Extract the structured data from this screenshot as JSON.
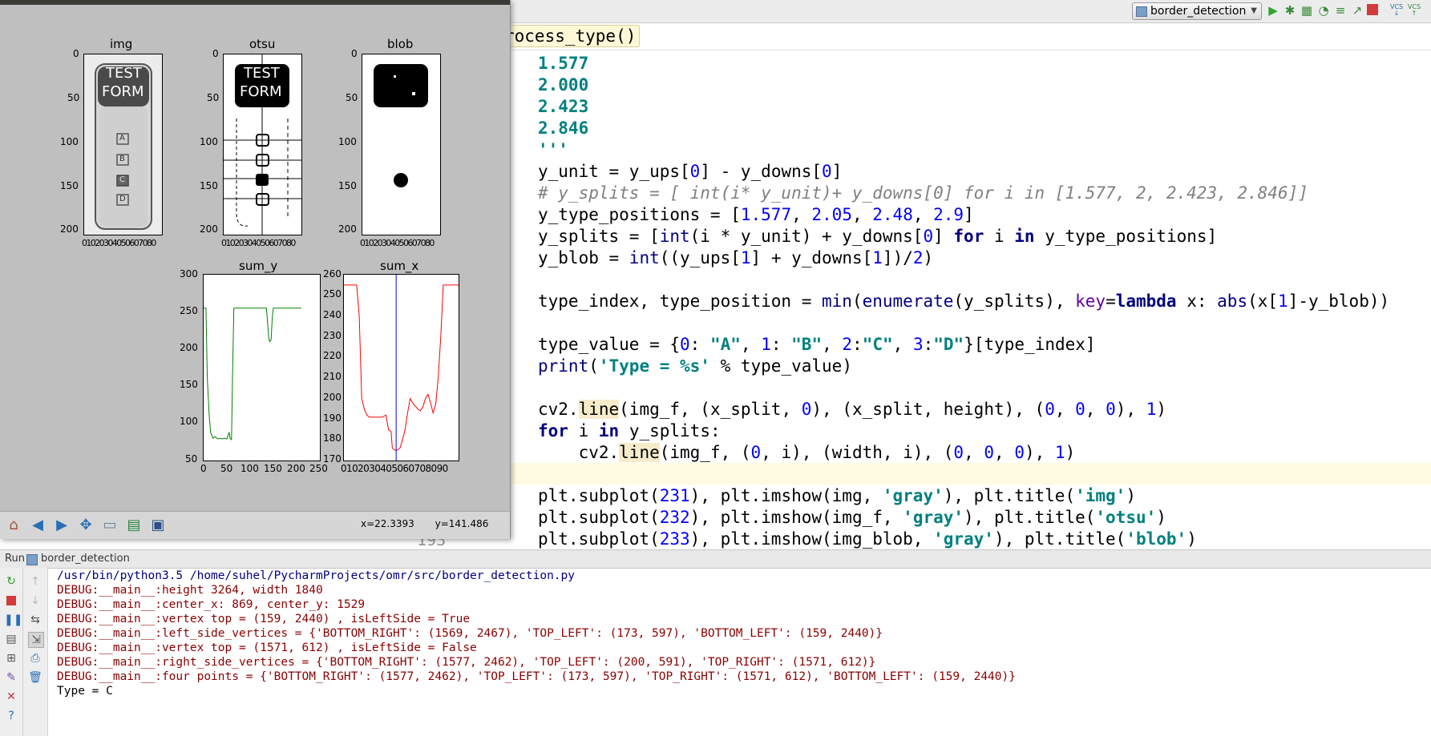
{
  "toolbar": {
    "run_config": "border_detection",
    "vcs_label": "VCS"
  },
  "editor": {
    "crumb": "rocess_type()",
    "behind_window_line_no": "193"
  },
  "matplotlib": {
    "coords": {
      "x": "x=22.3393",
      "y": "y=141.486"
    },
    "plots": {
      "img": {
        "title": "img",
        "form_text": [
          "TEST",
          "FORM"
        ],
        "options": [
          "A",
          "B",
          "C",
          "D"
        ]
      },
      "otsu": {
        "title": "otsu",
        "form_text": [
          "TEST",
          "FORM"
        ]
      },
      "blob": {
        "title": "blob"
      },
      "sum_y": {
        "title": "sum_y"
      },
      "sum_x": {
        "title": "sum_x"
      }
    },
    "image_axes": {
      "yticks": [
        "0",
        "50",
        "100",
        "150",
        "200"
      ],
      "xticks": "01020304050607080"
    },
    "sum_y_axes": {
      "yticks": [
        "300",
        "250",
        "200",
        "150",
        "100",
        "50"
      ],
      "xticks": [
        "0",
        "50",
        "100",
        "150",
        "200",
        "250"
      ]
    },
    "sum_x_axes": {
      "yticks": [
        "260",
        "250",
        "240",
        "230",
        "220",
        "210",
        "200",
        "190",
        "180",
        "170"
      ],
      "xticks": "0102030405060708090"
    }
  },
  "chart_data": [
    {
      "type": "line",
      "title": "sum_y",
      "xlim": [
        0,
        250
      ],
      "ylim": [
        50,
        300
      ],
      "series": [
        {
          "color": "#008000",
          "x": [
            0,
            5,
            8,
            12,
            15,
            20,
            25,
            30,
            35,
            40,
            45,
            50,
            55,
            57,
            60,
            62,
            65,
            70,
            80,
            100,
            120,
            135,
            137,
            140,
            142,
            145,
            148,
            150,
            155,
            180,
            210
          ],
          "y": [
            255,
            255,
            160,
            110,
            88,
            80,
            82,
            79,
            80,
            79,
            80,
            79,
            88,
            80,
            78,
            160,
            255,
            255,
            255,
            255,
            255,
            255,
            240,
            215,
            210,
            212,
            245,
            255,
            255,
            255,
            255
          ]
        }
      ]
    },
    {
      "type": "line",
      "title": "sum_x",
      "xlim": [
        0,
        90
      ],
      "ylim": [
        170,
        260
      ],
      "vline": {
        "x": 41,
        "color": "#0000ff"
      },
      "series": [
        {
          "color": "#ff0000",
          "x": [
            0,
            5,
            10,
            12,
            14,
            16,
            18,
            20,
            25,
            30,
            33,
            35,
            37,
            38,
            40,
            42,
            44,
            46,
            48,
            50,
            52,
            55,
            58,
            60,
            62,
            64,
            66,
            68,
            70,
            72,
            74,
            76,
            78,
            80,
            90
          ],
          "y": [
            255,
            255,
            255,
            240,
            200,
            195,
            192,
            191,
            191,
            191,
            192,
            185,
            184,
            176,
            175,
            175,
            176,
            180,
            185,
            193,
            200,
            197,
            195,
            194,
            196,
            200,
            202,
            198,
            193,
            197,
            210,
            230,
            255,
            255,
            255
          ]
        }
      ]
    }
  ],
  "code_lines": [
    [
      {
        "t": "1.577",
        "c": "str"
      }
    ],
    [
      {
        "t": "2.000",
        "c": "str"
      }
    ],
    [
      {
        "t": "2.423",
        "c": "str"
      }
    ],
    [
      {
        "t": "2.846",
        "c": "str"
      }
    ],
    [
      {
        "t": "'''",
        "c": "str"
      }
    ],
    [
      {
        "t": "y_unit = y_ups["
      },
      {
        "t": "0",
        "c": "num"
      },
      {
        "t": "] - y_downs["
      },
      {
        "t": "0",
        "c": "num"
      },
      {
        "t": "]"
      }
    ],
    [
      {
        "t": "# y_splits = [ int(i* y_unit)+ y_downs[0] for i in [1.577, 2, 2.423, 2.846]]",
        "c": "cmt"
      }
    ],
    [
      {
        "t": "y_type_positions = ["
      },
      {
        "t": "1.577",
        "c": "num"
      },
      {
        "t": ", "
      },
      {
        "t": "2.05",
        "c": "num"
      },
      {
        "t": ", "
      },
      {
        "t": "2.48",
        "c": "num"
      },
      {
        "t": ", "
      },
      {
        "t": "2.9",
        "c": "num"
      },
      {
        "t": "]"
      }
    ],
    [
      {
        "t": "y_splits = ["
      },
      {
        "t": "int",
        "c": "bi"
      },
      {
        "t": "(i * y_unit) + y_downs["
      },
      {
        "t": "0",
        "c": "num"
      },
      {
        "t": "] "
      },
      {
        "t": "for",
        "c": "kw"
      },
      {
        "t": " i "
      },
      {
        "t": "in",
        "c": "kw"
      },
      {
        "t": " y_type_positions]"
      }
    ],
    [
      {
        "t": "y_blob = "
      },
      {
        "t": "int",
        "c": "bi"
      },
      {
        "t": "((y_ups["
      },
      {
        "t": "1",
        "c": "num"
      },
      {
        "t": "] + y_downs["
      },
      {
        "t": "1",
        "c": "num"
      },
      {
        "t": "])/"
      },
      {
        "t": "2",
        "c": "num"
      },
      {
        "t": ")"
      }
    ],
    [
      {
        "t": ""
      }
    ],
    [
      {
        "t": "type_index, type_position = "
      },
      {
        "t": "min",
        "c": "bi"
      },
      {
        "t": "("
      },
      {
        "t": "enumerate",
        "c": "bi"
      },
      {
        "t": "(y_splits), "
      },
      {
        "t": "key",
        "c": "kwarg"
      },
      {
        "t": "="
      },
      {
        "t": "lambda",
        "c": "kw"
      },
      {
        "t": " x: "
      },
      {
        "t": "abs",
        "c": "bi"
      },
      {
        "t": "(x["
      },
      {
        "t": "1",
        "c": "num"
      },
      {
        "t": "]-y_blob))"
      }
    ],
    [
      {
        "t": ""
      }
    ],
    [
      {
        "t": "type_value = {"
      },
      {
        "t": "0",
        "c": "num"
      },
      {
        "t": ": "
      },
      {
        "t": "\"A\"",
        "c": "str"
      },
      {
        "t": ", "
      },
      {
        "t": "1",
        "c": "num"
      },
      {
        "t": ": "
      },
      {
        "t": "\"B\"",
        "c": "str"
      },
      {
        "t": ", "
      },
      {
        "t": "2",
        "c": "num"
      },
      {
        "t": ":"
      },
      {
        "t": "\"C\"",
        "c": "str"
      },
      {
        "t": ", "
      },
      {
        "t": "3",
        "c": "num"
      },
      {
        "t": ":"
      },
      {
        "t": "\"D\"",
        "c": "str"
      },
      {
        "t": "}[type_index]"
      }
    ],
    [
      {
        "t": "print",
        "c": "bi"
      },
      {
        "t": "("
      },
      {
        "t": "'Type = %s'",
        "c": "str"
      },
      {
        "t": " % type_value)"
      }
    ],
    [
      {
        "t": ""
      }
    ],
    [
      {
        "t": "cv2."
      },
      {
        "t": "line",
        "c": "hl"
      },
      {
        "t": "(img_f, (x_split, "
      },
      {
        "t": "0",
        "c": "num"
      },
      {
        "t": "), (x_split, height), ("
      },
      {
        "t": "0",
        "c": "num"
      },
      {
        "t": ", "
      },
      {
        "t": "0",
        "c": "num"
      },
      {
        "t": ", "
      },
      {
        "t": "0",
        "c": "num"
      },
      {
        "t": "), "
      },
      {
        "t": "1",
        "c": "num"
      },
      {
        "t": ")"
      }
    ],
    [
      {
        "t": "for",
        "c": "kw"
      },
      {
        "t": " i "
      },
      {
        "t": "in",
        "c": "kw"
      },
      {
        "t": " y_splits:"
      }
    ],
    [
      {
        "t": "    cv2."
      },
      {
        "t": "line",
        "c": "hl"
      },
      {
        "t": "(img_f, ("
      },
      {
        "t": "0",
        "c": "num"
      },
      {
        "t": ", i), (width, i), ("
      },
      {
        "t": "0",
        "c": "num"
      },
      {
        "t": ", "
      },
      {
        "t": "0",
        "c": "num"
      },
      {
        "t": ", "
      },
      {
        "t": "0",
        "c": "num"
      },
      {
        "t": "), "
      },
      {
        "t": "1",
        "c": "num"
      },
      {
        "t": ")"
      }
    ],
    [
      {
        "t": ""
      }
    ],
    [
      {
        "t": "plt.subplot("
      },
      {
        "t": "231",
        "c": "num"
      },
      {
        "t": "), plt.imshow(img, "
      },
      {
        "t": "'gray'",
        "c": "str"
      },
      {
        "t": "), plt.title("
      },
      {
        "t": "'img'",
        "c": "str"
      },
      {
        "t": ")"
      }
    ],
    [
      {
        "t": "plt.subplot("
      },
      {
        "t": "232",
        "c": "num"
      },
      {
        "t": "), plt.imshow(img_f, "
      },
      {
        "t": "'gray'",
        "c": "str"
      },
      {
        "t": "), plt.title("
      },
      {
        "t": "'otsu'",
        "c": "str"
      },
      {
        "t": ")"
      }
    ],
    [
      {
        "t": "plt.subplot("
      },
      {
        "t": "233",
        "c": "num"
      },
      {
        "t": "), plt.imshow(img_blob, "
      },
      {
        "t": "'gray'",
        "c": "str"
      },
      {
        "t": "), plt.title("
      },
      {
        "t": "'blob'",
        "c": "str"
      },
      {
        "t": ")"
      }
    ]
  ],
  "run_panel": {
    "label": "Run",
    "config": "border_detection",
    "console": [
      {
        "kind": "cmd",
        "text": "/usr/bin/python3.5 /home/suhel/PycharmProjects/omr/src/border_detection.py"
      },
      {
        "kind": "dbg",
        "text": "DEBUG:__main__:height 3264, width 1840"
      },
      {
        "kind": "dbg",
        "text": "DEBUG:__main__:center_x: 869, center_y: 1529"
      },
      {
        "kind": "dbg",
        "text": "DEBUG:__main__:vertex top = (159, 2440) , isLeftSide = True"
      },
      {
        "kind": "dbg",
        "text": "DEBUG:__main__:left_side_vertices = {'BOTTOM_RIGHT': (1569, 2467), 'TOP_LEFT': (173, 597), 'BOTTOM_LEFT': (159, 2440)}"
      },
      {
        "kind": "dbg",
        "text": "DEBUG:__main__:vertex top = (1571, 612) , isLeftSide = False"
      },
      {
        "kind": "dbg",
        "text": "DEBUG:__main__:right_side_vertices = {'BOTTOM_RIGHT': (1577, 2462), 'TOP_LEFT': (200, 591), 'TOP_RIGHT': (1571, 612)}"
      },
      {
        "kind": "dbg",
        "text": "DEBUG:__main__:four points = {'BOTTOM_RIGHT': (1577, 2462), 'TOP_LEFT': (173, 597), 'TOP_RIGHT': (1571, 612), 'BOTTOM_LEFT': (159, 2440)}"
      },
      {
        "kind": "out",
        "text": "Type = C"
      }
    ]
  }
}
